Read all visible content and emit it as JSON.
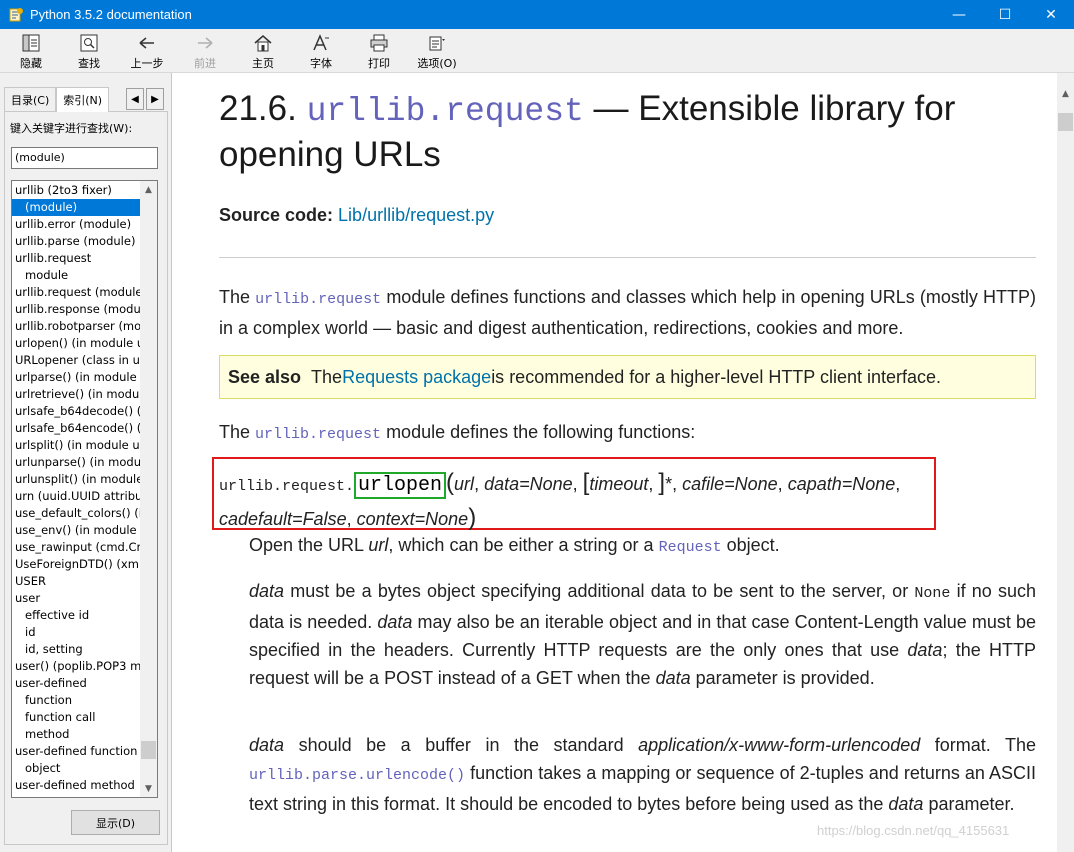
{
  "window": {
    "title": "Python 3.5.2 documentation",
    "controls": [
      "—",
      "☐",
      "✕"
    ]
  },
  "toolbar": {
    "hide": "隐藏",
    "find": "查找",
    "back": "上一步",
    "forward": "前进",
    "home": "主页",
    "font": "字体",
    "print": "打印",
    "options": "选项(O)"
  },
  "nav": {
    "tab_contents": "目录(C)",
    "tab_index": "索引(N)",
    "search_label": "键入关键字进行查找(W):",
    "search_value": "(module)",
    "show_button": "显示(D)",
    "index_items": [
      {
        "text": "urllib (2to3 fixer)",
        "sub": false,
        "selected": false
      },
      {
        "text": "(module)",
        "sub": true,
        "selected": true
      },
      {
        "text": "urllib.error (module)",
        "sub": false,
        "selected": false
      },
      {
        "text": "urllib.parse (module)",
        "sub": false,
        "selected": false
      },
      {
        "text": "urllib.request",
        "sub": false,
        "selected": false
      },
      {
        "text": "module",
        "sub": true,
        "selected": false
      },
      {
        "text": "urllib.request (module",
        "sub": false,
        "selected": false
      },
      {
        "text": "urllib.response (modu",
        "sub": false,
        "selected": false
      },
      {
        "text": "urllib.robotparser (mo",
        "sub": false,
        "selected": false
      },
      {
        "text": "urlopen() (in module u",
        "sub": false,
        "selected": false
      },
      {
        "text": "URLopener (class in u",
        "sub": false,
        "selected": false
      },
      {
        "text": "urlparse() (in module",
        "sub": false,
        "selected": false
      },
      {
        "text": "urlretrieve() (in modul",
        "sub": false,
        "selected": false
      },
      {
        "text": "urlsafe_b64decode() (",
        "sub": false,
        "selected": false
      },
      {
        "text": "urlsafe_b64encode() (",
        "sub": false,
        "selected": false
      },
      {
        "text": "urlsplit() (in module u",
        "sub": false,
        "selected": false
      },
      {
        "text": "urlunparse() (in modu",
        "sub": false,
        "selected": false
      },
      {
        "text": "urlunsplit() (in module",
        "sub": false,
        "selected": false
      },
      {
        "text": "urn (uuid.UUID attribu",
        "sub": false,
        "selected": false
      },
      {
        "text": "use_default_colors() (i",
        "sub": false,
        "selected": false
      },
      {
        "text": "use_env() (in module c",
        "sub": false,
        "selected": false
      },
      {
        "text": "use_rawinput (cmd.Cm",
        "sub": false,
        "selected": false
      },
      {
        "text": "UseForeignDTD() (xm",
        "sub": false,
        "selected": false
      },
      {
        "text": "USER",
        "sub": false,
        "selected": false
      },
      {
        "text": "user",
        "sub": false,
        "selected": false
      },
      {
        "text": "effective id",
        "sub": true,
        "selected": false
      },
      {
        "text": "id",
        "sub": true,
        "selected": false
      },
      {
        "text": "id, setting",
        "sub": true,
        "selected": false
      },
      {
        "text": "user() (poplib.POP3 m",
        "sub": false,
        "selected": false
      },
      {
        "text": "user-defined",
        "sub": false,
        "selected": false
      },
      {
        "text": "function",
        "sub": true,
        "selected": false
      },
      {
        "text": "function call",
        "sub": true,
        "selected": false
      },
      {
        "text": "method",
        "sub": true,
        "selected": false
      },
      {
        "text": "user-defined function",
        "sub": false,
        "selected": false
      },
      {
        "text": "object",
        "sub": true,
        "selected": false
      },
      {
        "text": "user-defined method",
        "sub": false,
        "selected": false
      }
    ]
  },
  "doc": {
    "title_prefix": "21.6. ",
    "title_module": "urllib.request",
    "title_rest": " — Extensible library for opening URLs",
    "source_label": "Source code:",
    "source_link": "Lib/urllib/request.py",
    "intro_1": "The ",
    "intro_module": "urllib.request",
    "intro_2": " module defines functions and classes which help in opening URLs (mostly HTTP) in a complex world — basic and digest authentication, redirections, cookies and more.",
    "seealso_label": "See also",
    "seealso_1": "The ",
    "seealso_link": "Requests package",
    "seealso_2": " is recommended for a higher-level HTTP client interface.",
    "funcs_1": "The ",
    "funcs_module": "urllib.request",
    "funcs_2": " module defines the following functions:",
    "sig_prefix": "urllib.request.",
    "sig_name": "urlopen",
    "sig_open": "(",
    "sig_url": "url",
    "sig_data": "data=None",
    "sig_lbr": "[",
    "sig_timeout": "timeout",
    "sig_rbr": "]",
    "sig_star": "*",
    "sig_cafile": "cafile=None",
    "sig_capath": "capath=None",
    "sig_cadefault": "cadefault=False",
    "sig_context": "context=None",
    "sig_close": ")",
    "p1_a": "Open the URL ",
    "p1_url": "url",
    "p1_b": ", which can be either a string or a ",
    "p1_request": "Request",
    "p1_c": " object.",
    "p2_data1": "data",
    "p2_a": " must be a bytes object specifying additional data to be sent to the server, or ",
    "p2_none": "None",
    "p2_b": " if no such data is needed. ",
    "p2_data2": "data",
    "p2_c": " may also be an iterable object and in that case Content-Length value must be specified in the headers. Currently HTTP requests are the only ones that use ",
    "p2_data3": "data",
    "p2_d": "; the HTTP request will be a POST instead of a GET when the ",
    "p2_data4": "data",
    "p2_e": " parameter is provided.",
    "p3_data1": "data",
    "p3_a": " should be a buffer in the standard ",
    "p3_format": "application/x-www-form-urlencoded",
    "p3_b": " format. The ",
    "p3_func": "urllib.parse.urlencode()",
    "p3_c": " function takes a mapping or sequence of 2-tuples and returns an ASCII text string in this format. It should be encoded to bytes before being used as the ",
    "p3_data2": "data",
    "p3_d": " parameter."
  },
  "watermark": "https://blog.csdn.net/qq_4155631",
  "colors": {
    "titlebar": "#0078d7",
    "selection": "#0078d7",
    "link": "#0072aa",
    "code": "#6363bb",
    "highlight_red": "#e01a1a",
    "highlight_green": "#1fa829",
    "seealso_bg": "#ffffe0"
  }
}
